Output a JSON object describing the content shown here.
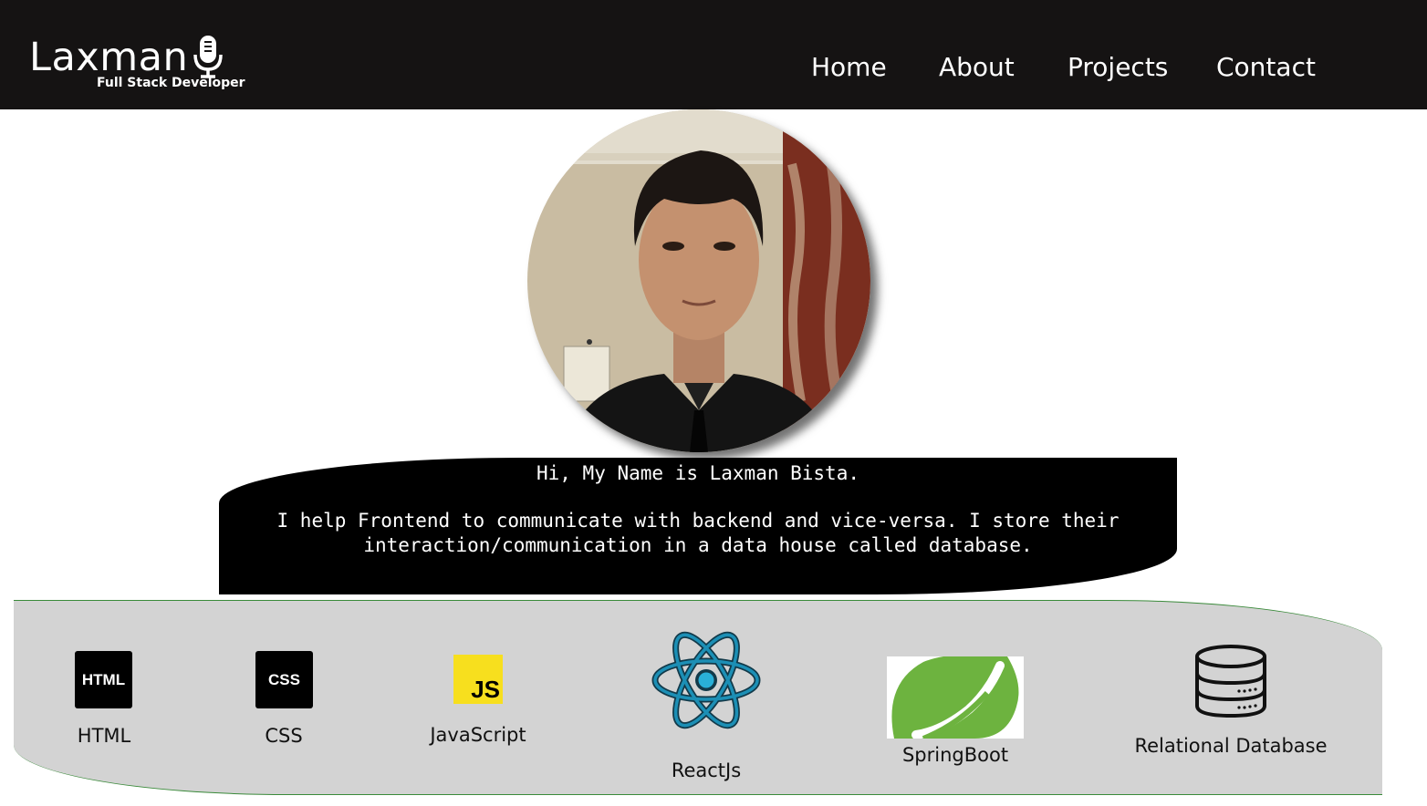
{
  "header": {
    "brand_name": "Laxman",
    "brand_tagline": "Full Stack Developer",
    "brand_icon": "microphone-icon",
    "nav": [
      {
        "label": "Home"
      },
      {
        "label": "About"
      },
      {
        "label": "Projects"
      },
      {
        "label": "Contact"
      }
    ]
  },
  "profile": {
    "photo": "profile-photo"
  },
  "intro": {
    "greeting": "Hi, My Name is Laxman Bista.",
    "description": "I help Frontend to communicate with backend and vice-versa. I store their interaction/communication in a data house called database."
  },
  "skills": [
    {
      "label": "HTML",
      "icon": "html-icon",
      "icon_text": "HTML"
    },
    {
      "label": "CSS",
      "icon": "css-icon",
      "icon_text": "CSS"
    },
    {
      "label": "JavaScript",
      "icon": "javascript-icon",
      "icon_text": "JS"
    },
    {
      "label": "ReactJs",
      "icon": "react-icon"
    },
    {
      "label": "SpringBoot",
      "icon": "spring-leaf-icon"
    },
    {
      "label": "Relational Database",
      "icon": "database-icon"
    }
  ],
  "colors": {
    "header_bg": "#151313",
    "intro_bg": "#000000",
    "skills_bg": "#d3d3d3",
    "js_yellow": "#f7df1e",
    "react_blue": "#1c8fb5",
    "spring_green": "#6db33f"
  }
}
